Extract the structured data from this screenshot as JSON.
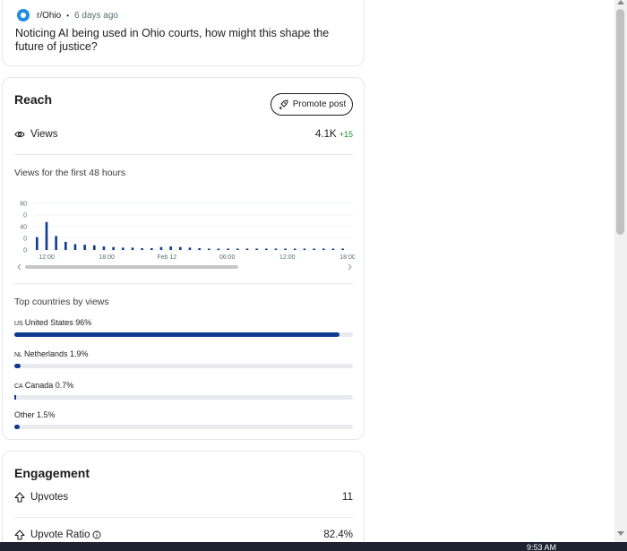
{
  "post": {
    "subreddit": "r/Ohio",
    "age": "6 days ago",
    "title": "Noticing AI being used in Ohio courts, how might this shape the future of justice?"
  },
  "reach": {
    "title": "Reach",
    "promote_label": "Promote post",
    "views_label": "Views",
    "views_value": "4.1K",
    "views_delta": "+15",
    "chart_subhead": "Views for the first 48 hours"
  },
  "chart_data": {
    "type": "bar",
    "title": "",
    "y_tick_labels": [
      "80",
      "0",
      "40",
      "0",
      "0"
    ],
    "x_tick_labels": [
      "12:00",
      "18:00",
      "Feb 12",
      "06:00",
      "12:00",
      "18:00"
    ],
    "values": [
      22,
      48,
      24,
      14,
      10,
      9,
      8,
      6,
      5,
      4,
      4,
      3,
      3,
      5,
      6,
      5,
      4,
      3,
      2,
      2,
      1,
      1,
      1,
      1,
      1,
      1,
      1,
      1,
      1,
      1,
      1,
      1,
      1
    ],
    "ylim": [
      0,
      80
    ],
    "color": "#0f3a8e"
  },
  "countries": {
    "title": "Top countries by views",
    "items": [
      {
        "code": "US",
        "name": "United States",
        "pct": "96%",
        "fraction": 0.96
      },
      {
        "code": "NL",
        "name": "Netherlands",
        "pct": "1.9%",
        "fraction": 0.019
      },
      {
        "code": "CA",
        "name": "Canada",
        "pct": "0.7%",
        "fraction": 0.007
      },
      {
        "code": "",
        "name": "Other",
        "pct": "1.5%",
        "fraction": 0.015
      }
    ]
  },
  "engagement": {
    "title": "Engagement",
    "upvotes_label": "Upvotes",
    "upvotes_value": "11",
    "ratio_label": "Upvote Ratio",
    "ratio_value": "82.4%"
  },
  "taskbar": {
    "clock": "9:53 AM"
  },
  "colors": {
    "accent": "#0f3a8e",
    "positive": "#1a8b24"
  }
}
